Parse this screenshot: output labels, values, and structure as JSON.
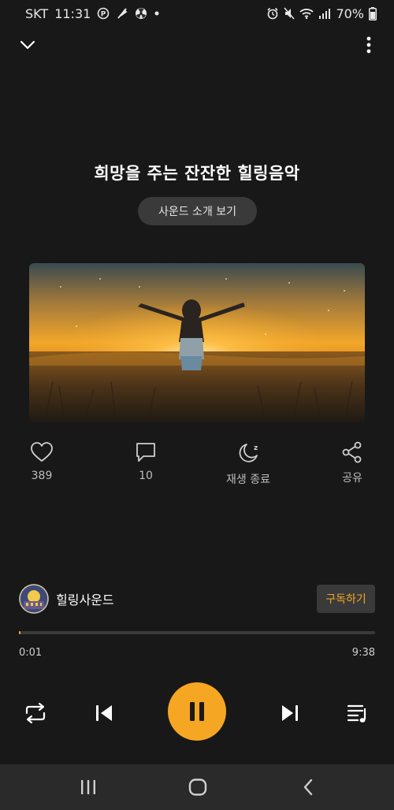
{
  "status_bar": {
    "carrier": "SKT",
    "time": "11:31",
    "battery": "70%"
  },
  "player": {
    "title": "희망을 주는 잔잔한 힐링음악",
    "about_label": "사운드 소개 보기",
    "actions": {
      "likes": "389",
      "comments": "10",
      "sleep_label": "재생 종료",
      "share_label": "공유"
    },
    "channel": {
      "name": "힐링사운드",
      "subscribe_label": "구독하기"
    },
    "progress": {
      "current": "0:01",
      "total": "9:38",
      "fraction": 0.002
    }
  },
  "colors": {
    "accent": "#f5a623",
    "background": "#181818",
    "button_bg": "#3a3a3a"
  },
  "icons": [
    "chevron-down-icon",
    "more-vertical-icon",
    "heart-icon",
    "comment-icon",
    "moon-icon",
    "share-icon",
    "repeat-icon",
    "skip-previous-icon",
    "pause-icon",
    "skip-next-icon",
    "queue-icon"
  ]
}
